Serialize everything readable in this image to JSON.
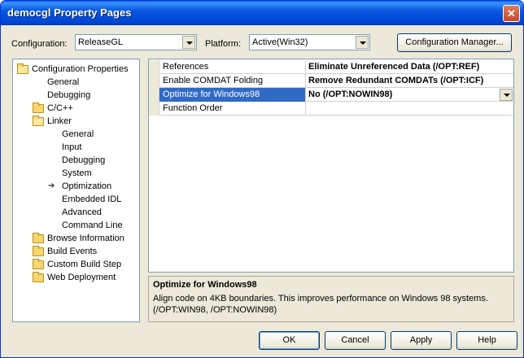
{
  "window": {
    "title": "democgl Property Pages",
    "close_label": "✕"
  },
  "config": {
    "configuration_label": "Configuration:",
    "configuration_value": "ReleaseGL",
    "platform_label": "Platform:",
    "platform_value": "Active(Win32)",
    "manager_button": "Configuration Manager..."
  },
  "tree": {
    "items": [
      {
        "label": "Configuration Properties"
      },
      {
        "label": "General"
      },
      {
        "label": "Debugging"
      },
      {
        "label": "C/C++"
      },
      {
        "label": "Linker"
      },
      {
        "label": "General"
      },
      {
        "label": "Input"
      },
      {
        "label": "Debugging"
      },
      {
        "label": "System"
      },
      {
        "label": "Optimization"
      },
      {
        "label": "Embedded IDL"
      },
      {
        "label": "Advanced"
      },
      {
        "label": "Command Line"
      },
      {
        "label": "Browse Information"
      },
      {
        "label": "Build Events"
      },
      {
        "label": "Custom Build Step"
      },
      {
        "label": "Web Deployment"
      }
    ]
  },
  "grid": {
    "rows": [
      {
        "name": "References",
        "value": "Eliminate Unreferenced Data (/OPT:REF)"
      },
      {
        "name": "Enable COMDAT Folding",
        "value": "Remove Redundant COMDATs (/OPT:ICF)"
      },
      {
        "name": "Optimize for Windows98",
        "value": "No (/OPT:NOWIN98)"
      },
      {
        "name": "Function Order",
        "value": ""
      }
    ]
  },
  "description": {
    "title": "Optimize for Windows98",
    "body": "Align code on 4KB boundaries. This improves performance on Windows 98 systems.   (/OPT:WIN98, /OPT:NOWIN98)"
  },
  "buttons": {
    "ok": "OK",
    "cancel": "Cancel",
    "apply": "Apply",
    "help": "Help"
  }
}
